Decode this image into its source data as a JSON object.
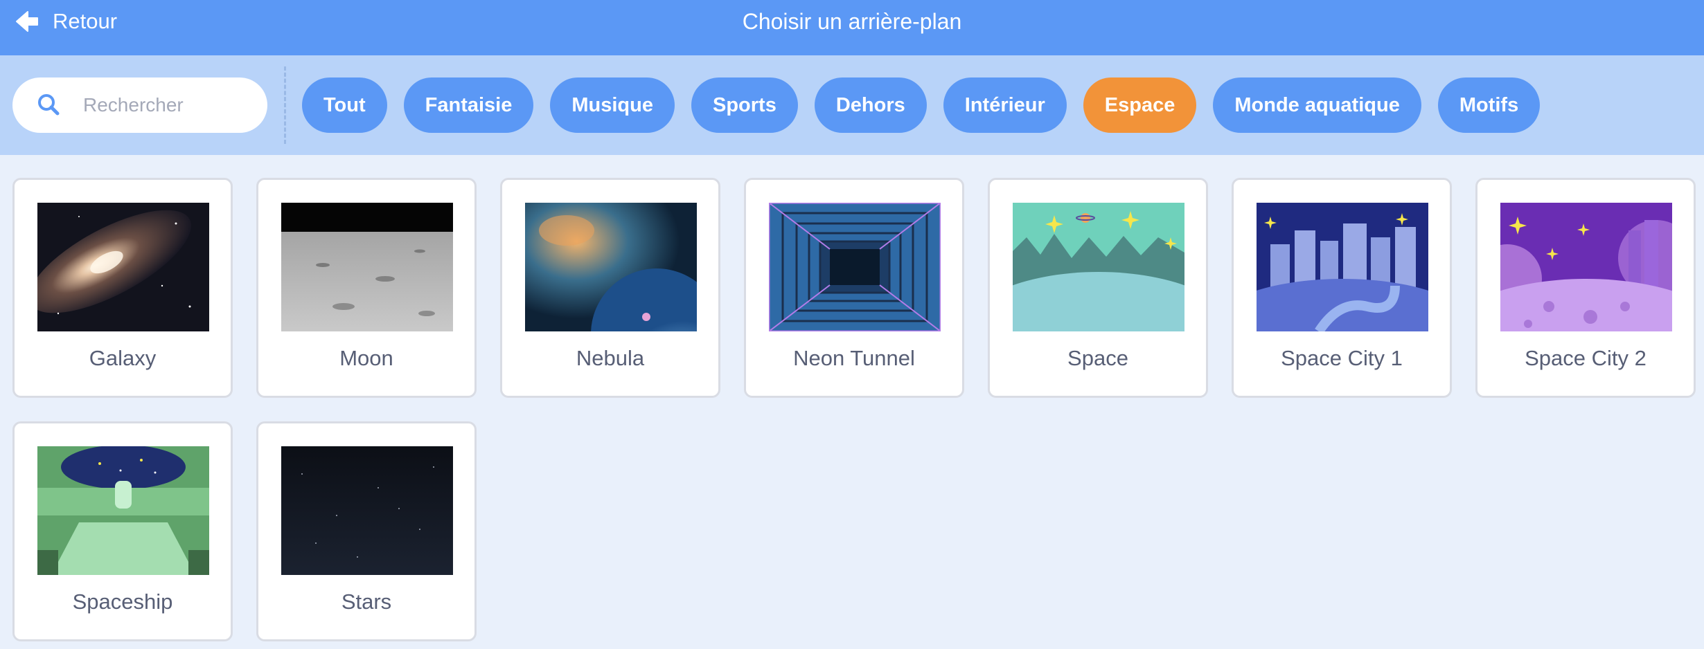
{
  "header": {
    "back_label": "Retour",
    "title": "Choisir un arrière-plan"
  },
  "search": {
    "placeholder": "Rechercher",
    "value": ""
  },
  "tags": [
    {
      "label": "Tout",
      "active": false
    },
    {
      "label": "Fantaisie",
      "active": false
    },
    {
      "label": "Musique",
      "active": false
    },
    {
      "label": "Sports",
      "active": false
    },
    {
      "label": "Dehors",
      "active": false
    },
    {
      "label": "Intérieur",
      "active": false
    },
    {
      "label": "Espace",
      "active": true
    },
    {
      "label": "Monde aquatique",
      "active": false
    },
    {
      "label": "Motifs",
      "active": false
    }
  ],
  "backdrops": [
    {
      "name": "Galaxy"
    },
    {
      "name": "Moon"
    },
    {
      "name": "Nebula"
    },
    {
      "name": "Neon Tunnel"
    },
    {
      "name": "Space"
    },
    {
      "name": "Space City 1"
    },
    {
      "name": "Space City 2"
    },
    {
      "name": "Spaceship"
    },
    {
      "name": "Stars"
    }
  ],
  "colors": {
    "header": "#5b98f5",
    "filterbar": "#b8d3f9",
    "tag": "#5b98f5",
    "tag_active": "#f29339",
    "background": "#e9f0fb"
  },
  "icons": {
    "back": "arrow-left-icon",
    "search": "magnifier-icon"
  }
}
